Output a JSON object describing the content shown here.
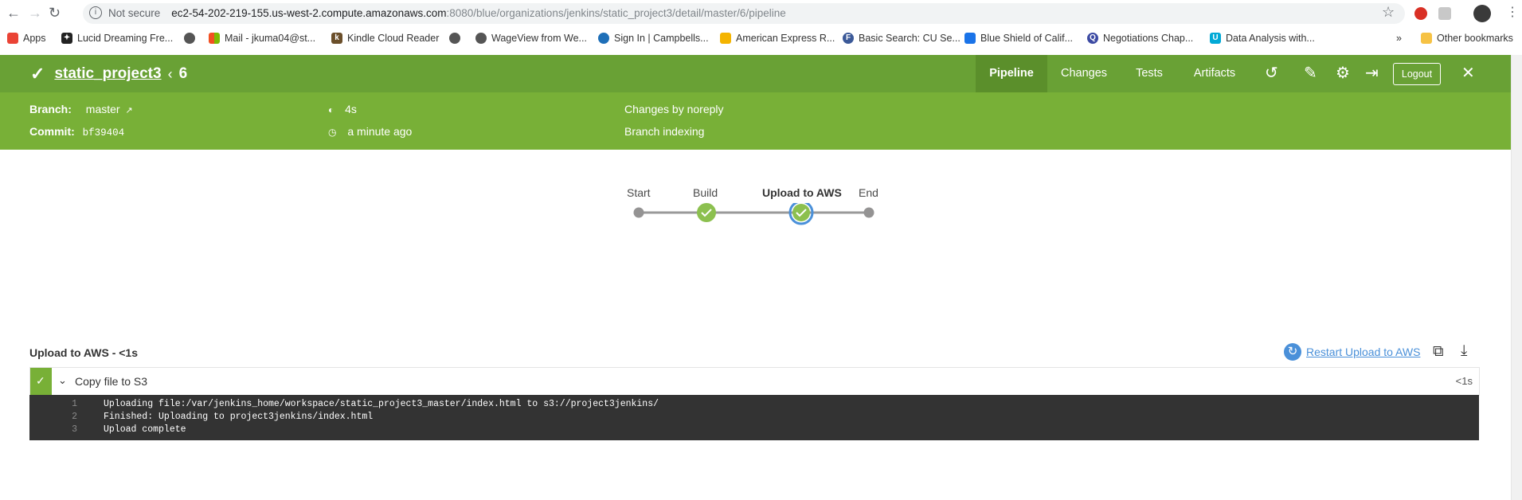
{
  "browser": {
    "not_secure": "Not secure",
    "url_host": "ec2-54-202-219-155.us-west-2.compute.amazonaws.com",
    "url_path": ":8080/blue/organizations/jenkins/static_project3/detail/master/6/pipeline",
    "bookmarks": [
      {
        "label": "Apps"
      },
      {
        "label": "Lucid Dreaming Fre..."
      },
      {
        "label": ""
      },
      {
        "label": "Mail - jkuma04@st..."
      },
      {
        "label": "Kindle Cloud Reader"
      },
      {
        "label": ""
      },
      {
        "label": "WageView from We..."
      },
      {
        "label": "Sign In | Campbells..."
      },
      {
        "label": "American Express R..."
      },
      {
        "label": "Basic Search: CU Se..."
      },
      {
        "label": "Blue Shield of Calif..."
      },
      {
        "label": "Negotiations Chap..."
      },
      {
        "label": "Data Analysis with..."
      }
    ],
    "more_bookmarks": "»",
    "other_bookmarks": "Other bookmarks"
  },
  "header": {
    "project": "static_project3",
    "run_number": "6",
    "tabs": [
      "Pipeline",
      "Changes",
      "Tests",
      "Artifacts"
    ],
    "logout": "Logout"
  },
  "summary": {
    "branch_label": "Branch:",
    "branch_value": "master",
    "commit_label": "Commit:",
    "commit_value": "bf39404",
    "duration": "4s",
    "time_ago": "a minute ago",
    "changes": "Changes by noreply",
    "cause": "Branch indexing"
  },
  "pipeline": {
    "stages": [
      "Start",
      "Build",
      "Upload to AWS",
      "End"
    ]
  },
  "log_section": {
    "title": "Upload to AWS - <1s",
    "restart": "Restart Upload to AWS",
    "step_label": "Copy file to S3",
    "step_duration": "<1s",
    "lines": [
      {
        "num": "1",
        "text": "Uploading file:/var/jenkins_home/workspace/static_project3_master/index.html to s3://project3jenkins/"
      },
      {
        "num": "2",
        "text": "Finished: Uploading to project3jenkins/index.html"
      },
      {
        "num": "3",
        "text": "Upload complete"
      }
    ]
  },
  "colors": {
    "header_dark": "#69a135",
    "header_light": "#78b037",
    "success": "#8cc04f",
    "selected_ring": "#4a90d9",
    "log_bg": "#333333"
  }
}
